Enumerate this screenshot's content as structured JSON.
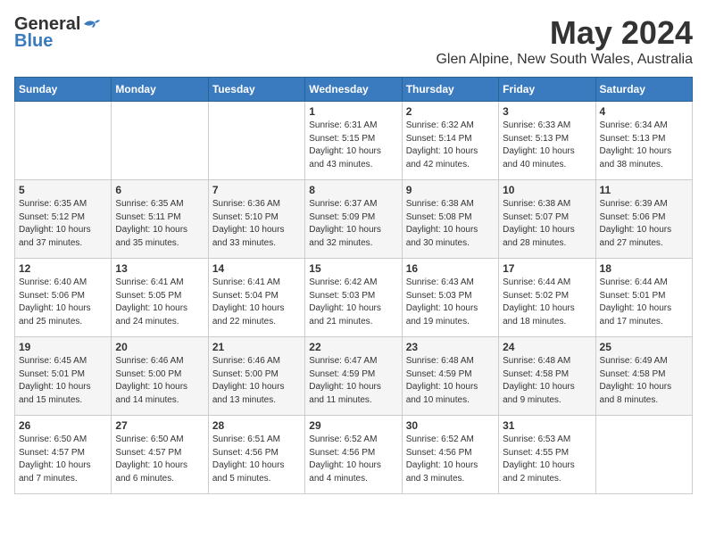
{
  "header": {
    "logo_general": "General",
    "logo_blue": "Blue",
    "month": "May 2024",
    "location": "Glen Alpine, New South Wales, Australia"
  },
  "weekdays": [
    "Sunday",
    "Monday",
    "Tuesday",
    "Wednesday",
    "Thursday",
    "Friday",
    "Saturday"
  ],
  "weeks": [
    [
      {
        "day": "",
        "sunrise": "",
        "sunset": "",
        "daylight": ""
      },
      {
        "day": "",
        "sunrise": "",
        "sunset": "",
        "daylight": ""
      },
      {
        "day": "",
        "sunrise": "",
        "sunset": "",
        "daylight": ""
      },
      {
        "day": "1",
        "sunrise": "Sunrise: 6:31 AM",
        "sunset": "Sunset: 5:15 PM",
        "daylight": "Daylight: 10 hours and 43 minutes."
      },
      {
        "day": "2",
        "sunrise": "Sunrise: 6:32 AM",
        "sunset": "Sunset: 5:14 PM",
        "daylight": "Daylight: 10 hours and 42 minutes."
      },
      {
        "day": "3",
        "sunrise": "Sunrise: 6:33 AM",
        "sunset": "Sunset: 5:13 PM",
        "daylight": "Daylight: 10 hours and 40 minutes."
      },
      {
        "day": "4",
        "sunrise": "Sunrise: 6:34 AM",
        "sunset": "Sunset: 5:13 PM",
        "daylight": "Daylight: 10 hours and 38 minutes."
      }
    ],
    [
      {
        "day": "5",
        "sunrise": "Sunrise: 6:35 AM",
        "sunset": "Sunset: 5:12 PM",
        "daylight": "Daylight: 10 hours and 37 minutes."
      },
      {
        "day": "6",
        "sunrise": "Sunrise: 6:35 AM",
        "sunset": "Sunset: 5:11 PM",
        "daylight": "Daylight: 10 hours and 35 minutes."
      },
      {
        "day": "7",
        "sunrise": "Sunrise: 6:36 AM",
        "sunset": "Sunset: 5:10 PM",
        "daylight": "Daylight: 10 hours and 33 minutes."
      },
      {
        "day": "8",
        "sunrise": "Sunrise: 6:37 AM",
        "sunset": "Sunset: 5:09 PM",
        "daylight": "Daylight: 10 hours and 32 minutes."
      },
      {
        "day": "9",
        "sunrise": "Sunrise: 6:38 AM",
        "sunset": "Sunset: 5:08 PM",
        "daylight": "Daylight: 10 hours and 30 minutes."
      },
      {
        "day": "10",
        "sunrise": "Sunrise: 6:38 AM",
        "sunset": "Sunset: 5:07 PM",
        "daylight": "Daylight: 10 hours and 28 minutes."
      },
      {
        "day": "11",
        "sunrise": "Sunrise: 6:39 AM",
        "sunset": "Sunset: 5:06 PM",
        "daylight": "Daylight: 10 hours and 27 minutes."
      }
    ],
    [
      {
        "day": "12",
        "sunrise": "Sunrise: 6:40 AM",
        "sunset": "Sunset: 5:06 PM",
        "daylight": "Daylight: 10 hours and 25 minutes."
      },
      {
        "day": "13",
        "sunrise": "Sunrise: 6:41 AM",
        "sunset": "Sunset: 5:05 PM",
        "daylight": "Daylight: 10 hours and 24 minutes."
      },
      {
        "day": "14",
        "sunrise": "Sunrise: 6:41 AM",
        "sunset": "Sunset: 5:04 PM",
        "daylight": "Daylight: 10 hours and 22 minutes."
      },
      {
        "day": "15",
        "sunrise": "Sunrise: 6:42 AM",
        "sunset": "Sunset: 5:03 PM",
        "daylight": "Daylight: 10 hours and 21 minutes."
      },
      {
        "day": "16",
        "sunrise": "Sunrise: 6:43 AM",
        "sunset": "Sunset: 5:03 PM",
        "daylight": "Daylight: 10 hours and 19 minutes."
      },
      {
        "day": "17",
        "sunrise": "Sunrise: 6:44 AM",
        "sunset": "Sunset: 5:02 PM",
        "daylight": "Daylight: 10 hours and 18 minutes."
      },
      {
        "day": "18",
        "sunrise": "Sunrise: 6:44 AM",
        "sunset": "Sunset: 5:01 PM",
        "daylight": "Daylight: 10 hours and 17 minutes."
      }
    ],
    [
      {
        "day": "19",
        "sunrise": "Sunrise: 6:45 AM",
        "sunset": "Sunset: 5:01 PM",
        "daylight": "Daylight: 10 hours and 15 minutes."
      },
      {
        "day": "20",
        "sunrise": "Sunrise: 6:46 AM",
        "sunset": "Sunset: 5:00 PM",
        "daylight": "Daylight: 10 hours and 14 minutes."
      },
      {
        "day": "21",
        "sunrise": "Sunrise: 6:46 AM",
        "sunset": "Sunset: 5:00 PM",
        "daylight": "Daylight: 10 hours and 13 minutes."
      },
      {
        "day": "22",
        "sunrise": "Sunrise: 6:47 AM",
        "sunset": "Sunset: 4:59 PM",
        "daylight": "Daylight: 10 hours and 11 minutes."
      },
      {
        "day": "23",
        "sunrise": "Sunrise: 6:48 AM",
        "sunset": "Sunset: 4:59 PM",
        "daylight": "Daylight: 10 hours and 10 minutes."
      },
      {
        "day": "24",
        "sunrise": "Sunrise: 6:48 AM",
        "sunset": "Sunset: 4:58 PM",
        "daylight": "Daylight: 10 hours and 9 minutes."
      },
      {
        "day": "25",
        "sunrise": "Sunrise: 6:49 AM",
        "sunset": "Sunset: 4:58 PM",
        "daylight": "Daylight: 10 hours and 8 minutes."
      }
    ],
    [
      {
        "day": "26",
        "sunrise": "Sunrise: 6:50 AM",
        "sunset": "Sunset: 4:57 PM",
        "daylight": "Daylight: 10 hours and 7 minutes."
      },
      {
        "day": "27",
        "sunrise": "Sunrise: 6:50 AM",
        "sunset": "Sunset: 4:57 PM",
        "daylight": "Daylight: 10 hours and 6 minutes."
      },
      {
        "day": "28",
        "sunrise": "Sunrise: 6:51 AM",
        "sunset": "Sunset: 4:56 PM",
        "daylight": "Daylight: 10 hours and 5 minutes."
      },
      {
        "day": "29",
        "sunrise": "Sunrise: 6:52 AM",
        "sunset": "Sunset: 4:56 PM",
        "daylight": "Daylight: 10 hours and 4 minutes."
      },
      {
        "day": "30",
        "sunrise": "Sunrise: 6:52 AM",
        "sunset": "Sunset: 4:56 PM",
        "daylight": "Daylight: 10 hours and 3 minutes."
      },
      {
        "day": "31",
        "sunrise": "Sunrise: 6:53 AM",
        "sunset": "Sunset: 4:55 PM",
        "daylight": "Daylight: 10 hours and 2 minutes."
      },
      {
        "day": "",
        "sunrise": "",
        "sunset": "",
        "daylight": ""
      }
    ]
  ]
}
